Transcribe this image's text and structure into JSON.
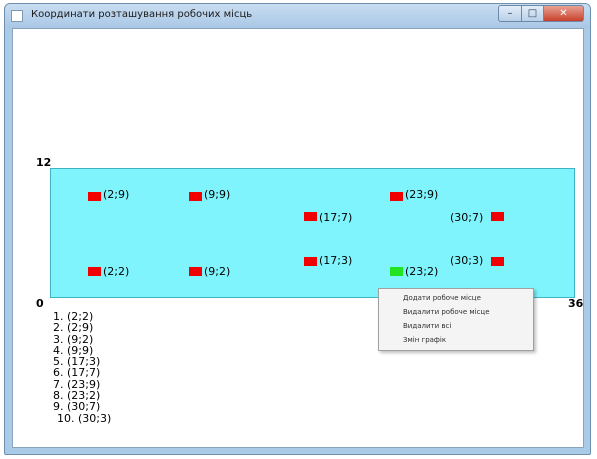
{
  "window": {
    "title": "Координати розташування робочих місць",
    "caption": {
      "minimize": "–",
      "maximize": "□",
      "close": "✕"
    },
    "icons": {
      "app": "app-icon"
    }
  },
  "plot": {
    "y_max_label": "12",
    "origin_label": "0",
    "x_max_label": "36",
    "room_color": "#80f4fc",
    "desk_color": "#f20000",
    "selected_desk_color": "#22e322",
    "x_range": [
      0,
      36
    ],
    "y_range": [
      0,
      12
    ]
  },
  "desks": [
    {
      "x": 2,
      "y": 9,
      "label": "(2;9)"
    },
    {
      "x": 9,
      "y": 9,
      "label": "(9;9)"
    },
    {
      "x": 23,
      "y": 9,
      "label": "(23;9)"
    },
    {
      "x": 17,
      "y": 7,
      "label": "(17;7)"
    },
    {
      "x": 30,
      "y": 7,
      "label": "(30;7)"
    },
    {
      "x": 2,
      "y": 2,
      "label": "(2;2)"
    },
    {
      "x": 9,
      "y": 2,
      "label": "(9;2)"
    },
    {
      "x": 17,
      "y": 3,
      "label": "(17;3)"
    },
    {
      "x": 23,
      "y": 2,
      "label": "(23;2)",
      "selected": true
    },
    {
      "x": 30,
      "y": 3,
      "label": "(30;3)"
    }
  ],
  "list": [
    "1. (2;2)",
    "2. (2;9)",
    "3. (9;2)",
    "4. (9;9)",
    "5. (17;3)",
    "6. (17;7)",
    "7. (23;9)",
    "8. (23;2)",
    "9. (30;7)",
    "10. (30;3)"
  ],
  "context_menu": [
    "Додати робоче місце",
    "Видалити робоче місце",
    "Видалити всі",
    "Змін графік"
  ]
}
